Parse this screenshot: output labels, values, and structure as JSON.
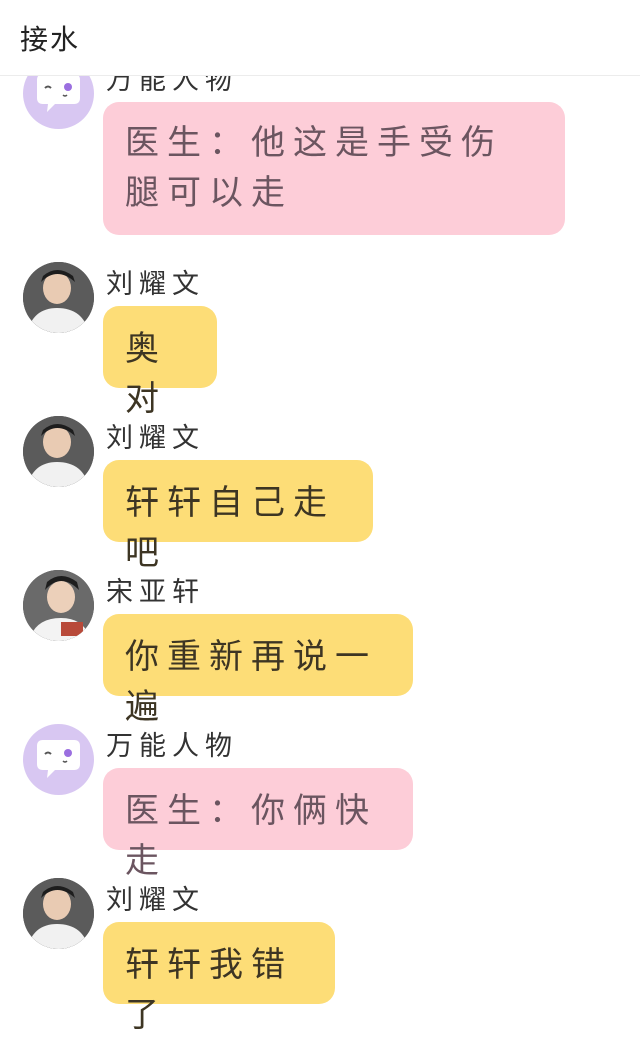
{
  "header": {
    "title": "接水"
  },
  "messages": [
    {
      "sender": "万能人物",
      "text": "医生：他这是手受伤腿可以走",
      "avatar": "chat-bubble-icon",
      "bubble_color": "#fdcdd8"
    },
    {
      "sender": "刘耀文",
      "text": "奥对",
      "avatar": "profile-photo",
      "bubble_color": "#fddd77"
    },
    {
      "sender": "刘耀文",
      "text": "轩轩自己走吧",
      "avatar": "profile-photo",
      "bubble_color": "#fddd77"
    },
    {
      "sender": "宋亚轩",
      "text": "你重新再说一遍",
      "avatar": "profile-photo",
      "bubble_color": "#fddd77"
    },
    {
      "sender": "万能人物",
      "text": "医生：你俩快走",
      "avatar": "chat-bubble-icon",
      "bubble_color": "#fdcdd8"
    },
    {
      "sender": "刘耀文",
      "text": "轩轩我错了",
      "avatar": "profile-photo",
      "bubble_color": "#fddd77"
    }
  ]
}
